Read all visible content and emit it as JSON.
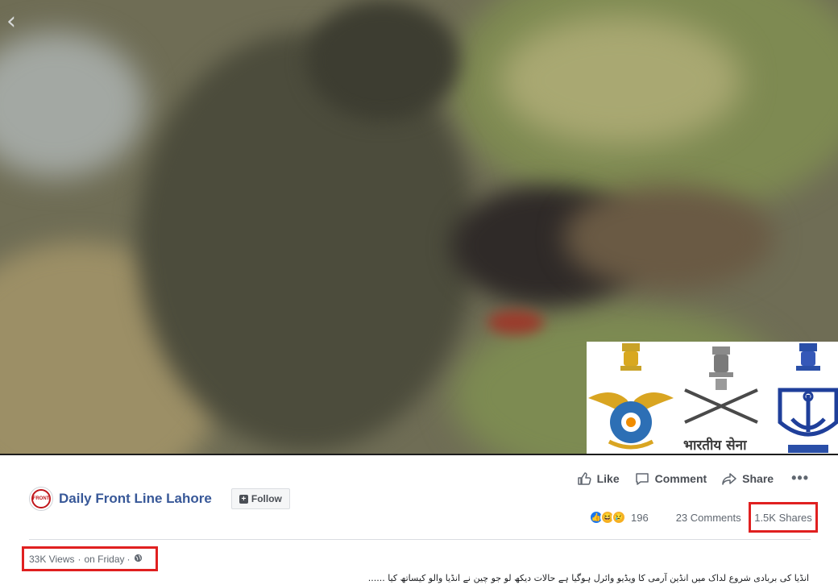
{
  "video": {
    "back_icon": "chevron-left-icon",
    "emblem_text": "भारतीय सेना"
  },
  "actions": {
    "like_label": "Like",
    "comment_label": "Comment",
    "share_label": "Share",
    "more_label": "•••"
  },
  "page": {
    "logo_text": "FRONT",
    "name": "Daily Front Line Lahore",
    "follow_label": "Follow"
  },
  "stats": {
    "reaction_count": "196",
    "comments": "23 Comments",
    "shares": "1.5K Shares"
  },
  "meta": {
    "views": "33K Views",
    "separator": "·",
    "posted": "on Friday",
    "globe_icon": "globe-icon"
  },
  "caption": "انڈیا کی بربادی شروع لداک میں انڈین آرمی کا ویڈیو وائرل ہوگیا ہے حالات دیکھ لو جو چین نے انڈیا والو کیساتھ کیا ......",
  "colors": {
    "link_blue": "#385898",
    "highlight_red": "#e02020",
    "like_blue": "#1877f2"
  }
}
